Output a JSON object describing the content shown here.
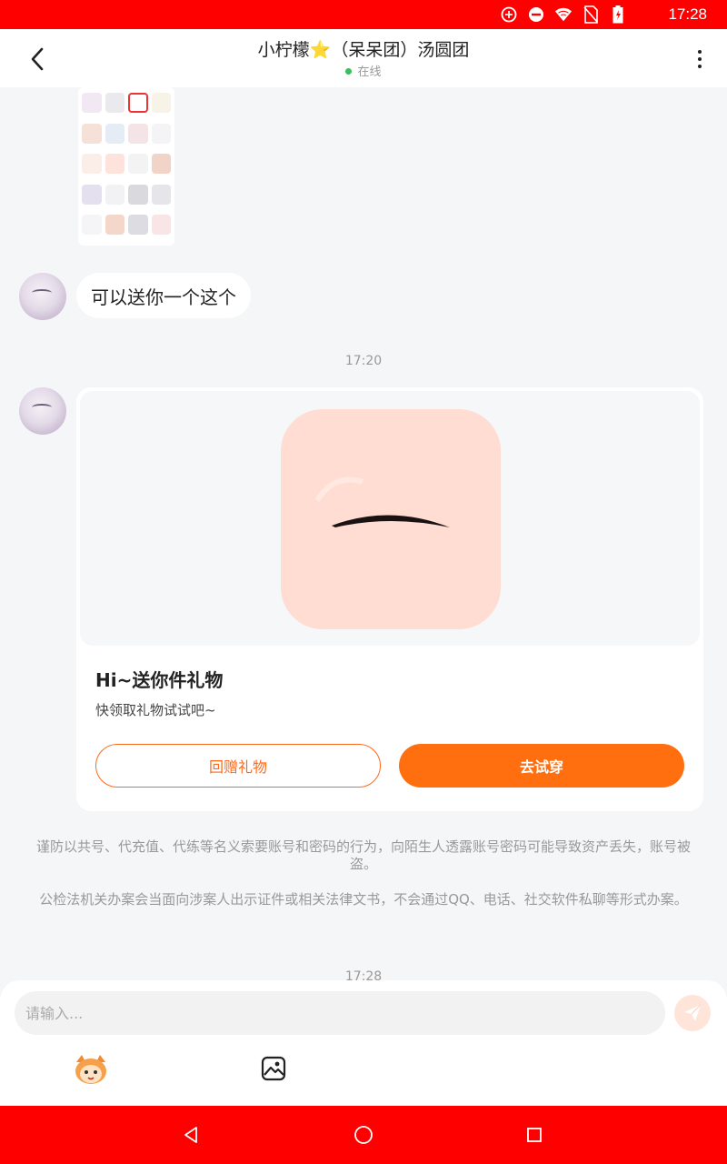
{
  "status_bar": {
    "time": "17:28",
    "icons": [
      "sync-icon",
      "do-not-disturb-icon",
      "wifi-icon",
      "no-sim-icon",
      "battery-charging-icon"
    ]
  },
  "header": {
    "title": "小柠檬⭐（呆呆团）汤圆团",
    "status": "在线"
  },
  "messages": {
    "text_message": "可以送你一个这个",
    "time_1": "17:20",
    "gift": {
      "title": "Hi~送你件礼物",
      "subtitle": "快领取礼物试试吧~",
      "return_button": "回赠礼物",
      "try_button": "去试穿"
    },
    "notice_1": "谨防以共号、代充值、代练等名义索要账号和密码的行为，向陌生人透露账号密码可能导致资产丢失，账号被盗。",
    "notice_2": "公检法机关办案会当面向涉案人出示证件或相关法律文书，不会通过QQ、电话、社交软件私聊等形式办案。",
    "time_2": "17:28"
  },
  "input": {
    "placeholder": "请输入..."
  },
  "colors": {
    "accent": "#ff6f10",
    "status_bar": "#ff0000",
    "online_dot": "#32c35a"
  }
}
